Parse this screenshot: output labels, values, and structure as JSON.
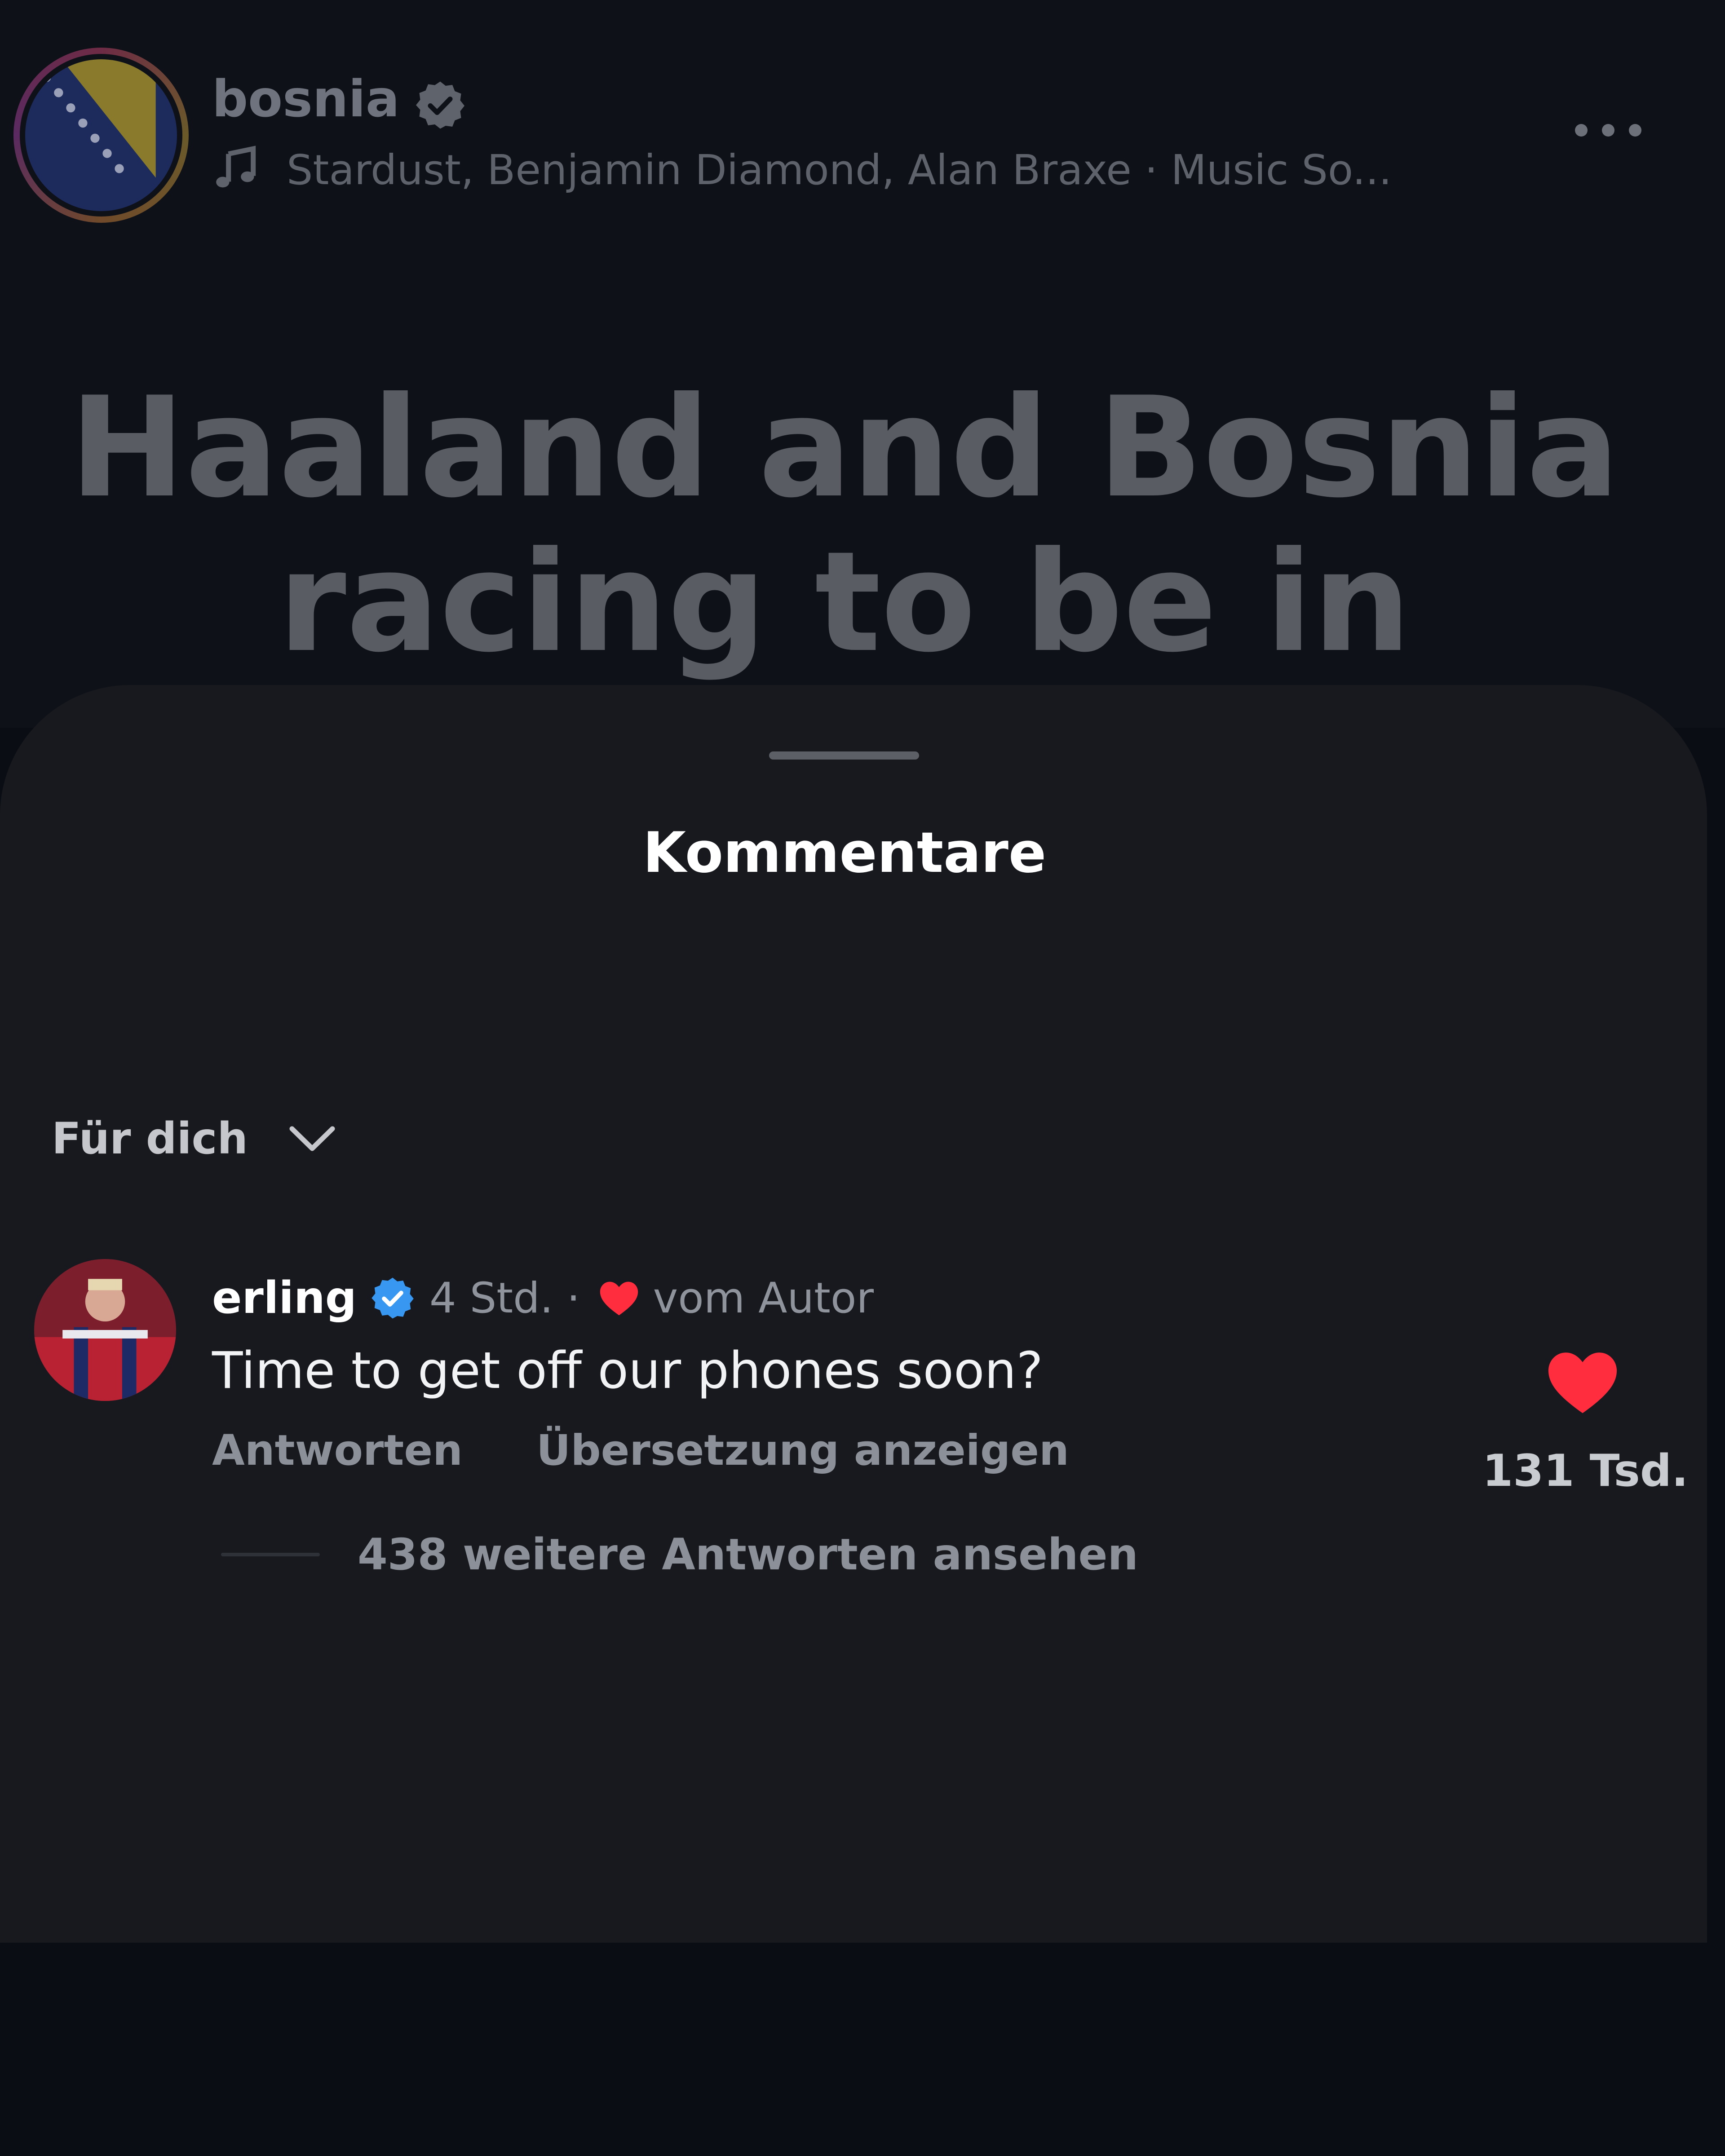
{
  "post": {
    "username": "bosnia",
    "audio": "Stardust, Benjamin Diamond, Alan Braxe · Music So...",
    "caption_lines": [
      "Haaland and Bosnia",
      "racing to be in"
    ],
    "avatar_icon": "bosnia-flag-icon",
    "more_icon": "more-options-icon"
  },
  "sheet": {
    "title": "Kommentare",
    "sort": {
      "label": "Für dich",
      "icon": "chevron-down-icon"
    }
  },
  "comment": {
    "user": "erling",
    "time": "4 Std.",
    "separator": "·",
    "author_badge": "vom Autor",
    "text": "Time to get off our phones soon?",
    "reply_label": "Antworten",
    "translate_label": "Übersetzung anzeigen",
    "like_count": "131 Tsd.",
    "view_replies": "438 weitere Antworten ansehen"
  },
  "colors": {
    "background": "#0b0d14",
    "sheet": "#17191f",
    "heart": "#ff2d3d",
    "verified": "#3897f0",
    "secondary_text": "#8f939b"
  }
}
